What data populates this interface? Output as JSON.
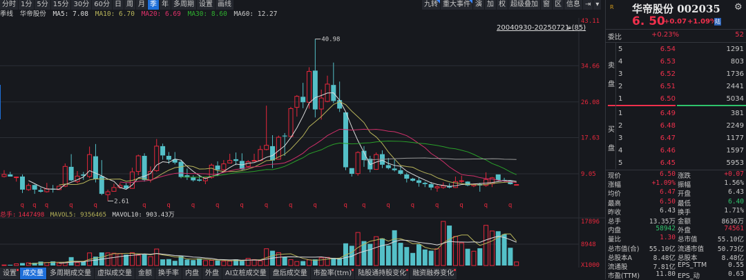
{
  "toolbar": {
    "left": [
      {
        "label": "分时"
      },
      {
        "label": "1分"
      },
      {
        "label": "5分"
      },
      {
        "label": "15分"
      },
      {
        "label": "30分"
      },
      {
        "label": "60分"
      },
      {
        "label": "日"
      },
      {
        "label": "周"
      },
      {
        "label": "月"
      },
      {
        "label": "季",
        "active": true
      },
      {
        "label": "年"
      },
      {
        "label": "多周期"
      },
      {
        "label": "设置"
      },
      {
        "label": "画线"
      }
    ],
    "right": [
      {
        "label": "九转",
        "flag": true
      },
      {
        "label": "重大事件",
        "flag": true
      },
      {
        "label": "演"
      },
      {
        "label": "加"
      },
      {
        "label": "权"
      },
      {
        "label": "超级叠加"
      },
      {
        "label": "窗"
      },
      {
        "label": "区"
      },
      {
        "label": "信息"
      },
      {
        "label": "⇥"
      },
      {
        "label": "▾"
      }
    ]
  },
  "info": {
    "period": "季线",
    "name": "华帝股份",
    "ma5": "MA5: 7.08",
    "ma10": "MA10: 6.70",
    "ma20": "MA20: 6.69",
    "ma30": "MA30: 8.60",
    "ma60": "MA60: 12.27"
  },
  "range_label": "20040930-20250721 (85)",
  "volume_header": {
    "label": "总手:",
    "value": "1447498",
    "mavol5": "MAVOL5: 9356465",
    "mavol10": "MAVOL10: 903.43万"
  },
  "bottom_tabs": [
    {
      "label": "设置",
      "dot": true
    },
    {
      "label": "成交量",
      "active": true
    },
    {
      "label": "多周期成交量"
    },
    {
      "label": "虚拟成交量"
    },
    {
      "label": "金额"
    },
    {
      "label": "换手率"
    },
    {
      "label": "内盘"
    },
    {
      "label": "外盘"
    },
    {
      "label": "AI立桩成交量"
    },
    {
      "label": "盘后成交量"
    },
    {
      "label": "市盈率(ttm)",
      "dot": true
    },
    {
      "label": "陆股通持股变化",
      "dot": true
    },
    {
      "label": "融资融券变化",
      "dot": true
    }
  ],
  "quote": {
    "badge": "R",
    "title": "华帝股份 002035",
    "price": "6. 50",
    "change": "+0.07",
    "pct": "+1.09%",
    "market": "陆",
    "weibi_label": "委比",
    "weibi_pct": "+0.23%",
    "weibi_val": "52",
    "sell_label": [
      "卖",
      "盘"
    ],
    "buy_label": [
      "买",
      "盘"
    ],
    "sell": [
      {
        "lv": "5",
        "p": "6.54",
        "v": "1291"
      },
      {
        "lv": "4",
        "p": "6.53",
        "v": "803"
      },
      {
        "lv": "3",
        "p": "6.52",
        "v": "1736"
      },
      {
        "lv": "2",
        "p": "6.51",
        "v": "2441"
      },
      {
        "lv": "1",
        "p": "6.50",
        "v": "5034"
      }
    ],
    "buy": [
      {
        "lv": "1",
        "p": "6.49",
        "v": "381"
      },
      {
        "lv": "2",
        "p": "6.48",
        "v": "2249"
      },
      {
        "lv": "3",
        "p": "6.47",
        "v": "1177"
      },
      {
        "lv": "4",
        "p": "6.46",
        "v": "1597"
      },
      {
        "lv": "5",
        "p": "6.45",
        "v": "5953"
      }
    ],
    "stats": [
      [
        {
          "l": "现价",
          "v": "6.50",
          "c": "red"
        },
        {
          "l": "涨跌",
          "v": "+0.07",
          "c": "red"
        }
      ],
      [
        {
          "l": "涨幅",
          "v": "+1.09%",
          "c": "red"
        },
        {
          "l": "振幅",
          "v": "1.56%",
          "c": "white"
        }
      ],
      [
        {
          "l": "均价",
          "v": "6.47",
          "c": "red"
        },
        {
          "l": "开盘",
          "v": "6.43",
          "c": "white"
        }
      ],
      [
        {
          "l": "最高",
          "v": "6.50",
          "c": "red"
        },
        {
          "l": "最低",
          "v": "6.40",
          "c": "green"
        }
      ],
      [
        {
          "l": "昨收",
          "v": "6.43",
          "c": "white"
        },
        {
          "l": "换手",
          "v": "1.71%",
          "c": "white"
        }
      ],
      [
        {
          "l": "总手",
          "v": "13.35万",
          "c": "white"
        },
        {
          "l": "金额",
          "v": "8636万",
          "c": "white"
        }
      ],
      [
        {
          "l": "内盘",
          "v": "58942",
          "c": "green"
        },
        {
          "l": "外盘",
          "v": "74561",
          "c": "red"
        }
      ],
      [
        {
          "l": "量比",
          "v": "1.30",
          "c": "red"
        },
        {
          "l": "总市值",
          "v": "55.10亿",
          "c": "white"
        }
      ],
      [
        {
          "l": "总市值(合)",
          "v": "55.10亿",
          "c": "white"
        },
        {
          "l": "流通市值",
          "v": "50.73亿",
          "c": "white"
        }
      ],
      [
        {
          "l": "总股本A",
          "v": "8.48亿",
          "c": "white"
        },
        {
          "l": "总股本",
          "v": "8.48亿",
          "c": "white"
        }
      ],
      [
        {
          "l": "流通股",
          "v": "7.81亿",
          "c": "white"
        },
        {
          "l": "EPS_TTM",
          "v": "0.55",
          "c": "white"
        }
      ],
      [
        {
          "l": "市盈(TTM)",
          "v": "11.80",
          "c": "white"
        },
        {
          "l": "EPS_动",
          "v": "0.63",
          "c": "white"
        }
      ]
    ]
  },
  "colors": {
    "up": "#e8283c",
    "down": "#54c0c8",
    "ma5": "#dcdcdc",
    "ma10": "#b8b45a",
    "ma20": "#d0306a",
    "ma30": "#2aa02a",
    "ma60": "#9a9a9a",
    "axis": "#e8283c"
  },
  "chart_data": {
    "type": "candlestick",
    "title": "华帝股份 季线",
    "y_ticks": [
      43.11,
      34.66,
      26.08,
      17.63,
      9.05
    ],
    "ylim": [
      2.0,
      43.11
    ],
    "high_label": "40.98",
    "low_label": "2.61",
    "high_index": 51,
    "low_index": 17,
    "marker_label": "q",
    "marker_indices": [
      3,
      5,
      7,
      11,
      15,
      23,
      27,
      31,
      35,
      39,
      43,
      47,
      51,
      56,
      59,
      63,
      67,
      71,
      75,
      79,
      83
    ],
    "ohlc": [
      [
        8.4,
        9.9,
        8.2,
        8.9
      ],
      [
        8.9,
        9.5,
        8.4,
        8.4
      ],
      [
        8.3,
        8.4,
        7.2,
        8.3
      ],
      [
        8.4,
        8.9,
        4.5,
        5.3
      ],
      [
        5.3,
        6.8,
        5.0,
        6.3
      ],
      [
        6.4,
        6.5,
        4.3,
        5.3
      ],
      [
        5.2,
        5.8,
        4.6,
        4.8
      ],
      [
        4.8,
        6.9,
        4.6,
        5.5
      ],
      [
        5.5,
        6.4,
        4.6,
        5.3
      ],
      [
        5.3,
        6.2,
        5.2,
        6.1
      ],
      [
        6.1,
        11.5,
        5.9,
        10.8
      ],
      [
        10.7,
        13.7,
        7.3,
        7.5
      ],
      [
        7.2,
        9.7,
        6.8,
        8.5
      ],
      [
        8.9,
        9.5,
        7.6,
        8.6
      ],
      [
        8.4,
        15.5,
        8.0,
        13.6
      ],
      [
        13.2,
        16.1,
        7.0,
        7.8
      ],
      [
        8.5,
        12.3,
        4.0,
        4.3
      ],
      [
        4.1,
        5.3,
        2.61,
        4.8
      ],
      [
        4.9,
        6.7,
        4.8,
        5.8
      ],
      [
        5.8,
        6.9,
        5.5,
        6.3
      ],
      [
        6.3,
        6.9,
        5.4,
        5.6
      ],
      [
        5.6,
        10.5,
        5.5,
        9.5
      ],
      [
        9.6,
        13.6,
        8.7,
        13.3
      ],
      [
        13.3,
        13.9,
        7.2,
        7.6
      ],
      [
        7.6,
        10.8,
        7.0,
        9.6
      ],
      [
        9.8,
        17.3,
        9.5,
        15.6
      ],
      [
        15.6,
        16.2,
        12.4,
        13.4
      ],
      [
        13.3,
        14.2,
        11.4,
        12.4
      ],
      [
        12.5,
        14.2,
        11.3,
        11.7
      ],
      [
        11.9,
        12.4,
        8.0,
        8.3
      ],
      [
        8.7,
        10.3,
        7.6,
        8.2
      ],
      [
        8.2,
        8.7,
        7.2,
        7.5
      ],
      [
        7.7,
        8.8,
        7.2,
        7.4
      ],
      [
        7.4,
        8.3,
        6.6,
        8.1
      ],
      [
        8.2,
        11.5,
        7.9,
        11.1
      ],
      [
        11.0,
        12.0,
        8.5,
        10.0
      ],
      [
        10.0,
        12.3,
        9.5,
        11.4
      ],
      [
        11.6,
        13.8,
        11.5,
        12.2
      ],
      [
        12.5,
        14.1,
        11.1,
        12.1
      ],
      [
        12.1,
        13.9,
        9.9,
        10.1
      ],
      [
        10.8,
        12.3,
        10.5,
        11.9
      ],
      [
        12.1,
        13.8,
        12.0,
        12.2
      ],
      [
        12.2,
        15.7,
        12.0,
        14.8
      ],
      [
        14.8,
        25.2,
        14.6,
        15.8
      ],
      [
        15.6,
        18.2,
        10.4,
        12.2
      ],
      [
        12.5,
        18.1,
        12.4,
        17.7
      ],
      [
        18.1,
        18.7,
        13.3,
        17.9
      ],
      [
        17.9,
        24.9,
        17.7,
        24.5
      ],
      [
        24.8,
        27.7,
        22.6,
        27.4
      ],
      [
        27.3,
        30.6,
        24.6,
        26.0
      ],
      [
        26.0,
        34.3,
        24.5,
        33.3
      ],
      [
        33.5,
        40.98,
        22.4,
        24.3
      ],
      [
        24.4,
        29.0,
        21.9,
        27.0
      ],
      [
        26.2,
        32.3,
        26.0,
        30.3
      ],
      [
        30.1,
        35.4,
        25.8,
        26.3
      ],
      [
        26.5,
        30.9,
        23.7,
        24.5
      ],
      [
        23.6,
        23.7,
        9.9,
        10.6
      ],
      [
        10.4,
        10.4,
        8.4,
        9.05
      ],
      [
        9.1,
        14.4,
        8.6,
        14.1
      ],
      [
        14.5,
        15.6,
        10.7,
        12.3
      ],
      [
        12.6,
        13.3,
        9.4,
        10.1
      ],
      [
        10.1,
        14.1,
        10.0,
        13.6
      ],
      [
        13.7,
        14.6,
        10.4,
        11.2
      ],
      [
        11.1,
        12.8,
        10.1,
        10.4
      ],
      [
        10.3,
        12.4,
        9.6,
        9.9
      ],
      [
        9.9,
        10.9,
        8.8,
        9.05
      ],
      [
        8.9,
        9.3,
        7.0,
        7.9
      ],
      [
        7.9,
        8.1,
        7.2,
        7.4
      ],
      [
        7.5,
        8.2,
        6.0,
        6.9
      ],
      [
        6.9,
        7.2,
        5.9,
        6.6
      ],
      [
        6.6,
        7.1,
        5.2,
        5.8
      ],
      [
        5.7,
        6.4,
        4.8,
        6.0
      ],
      [
        5.8,
        7.0,
        5.5,
        6.2
      ],
      [
        6.1,
        6.8,
        5.6,
        5.8
      ],
      [
        5.8,
        8.4,
        5.7,
        7.2
      ],
      [
        7.3,
        8.6,
        6.9,
        7.4
      ],
      [
        7.2,
        7.3,
        6.1,
        6.3
      ],
      [
        6.2,
        6.8,
        5.9,
        6.5
      ],
      [
        6.6,
        6.9,
        4.8,
        6.3
      ],
      [
        6.3,
        9.4,
        6.0,
        7.7
      ],
      [
        6.7,
        8.3,
        5.9,
        8.1
      ],
      [
        8.9,
        8.9,
        7.3,
        7.5
      ],
      [
        7.6,
        8.1,
        7.1,
        7.5
      ],
      [
        7.4,
        7.5,
        6.5,
        6.6
      ],
      [
        6.43,
        6.5,
        6.4,
        6.5
      ]
    ],
    "volume_unit": "X1000",
    "volume_ticks": [
      "17896",
      "8948",
      "X1000"
    ],
    "volume_max": 17896,
    "volume": [
      230,
      300,
      700,
      1000,
      1100,
      1100,
      1600,
      1200,
      1700,
      1000,
      1300,
      3400,
      1200,
      1600,
      5100,
      3600,
      5300,
      5100,
      5000,
      4900,
      4400,
      5200,
      4200,
      4500,
      3600,
      6700,
      2500,
      2600,
      1900,
      3800,
      2400,
      2200,
      2900,
      2000,
      2100,
      2000,
      1700,
      1800,
      2500,
      1900,
      2900,
      2400,
      1900,
      6800,
      6000,
      5200,
      3400,
      2400,
      1600,
      1800,
      2300,
      2500,
      3100,
      3300,
      3100,
      3000,
      9000,
      8000,
      13400,
      9900,
      8800,
      11700,
      11000,
      8100,
      14300,
      9200,
      7500,
      5100,
      8600,
      6500,
      6000,
      6800,
      17896,
      16200,
      11800,
      9200,
      6800,
      5800,
      7000,
      16300,
      14000,
      13900,
      12700,
      7200,
      1447
    ]
  }
}
